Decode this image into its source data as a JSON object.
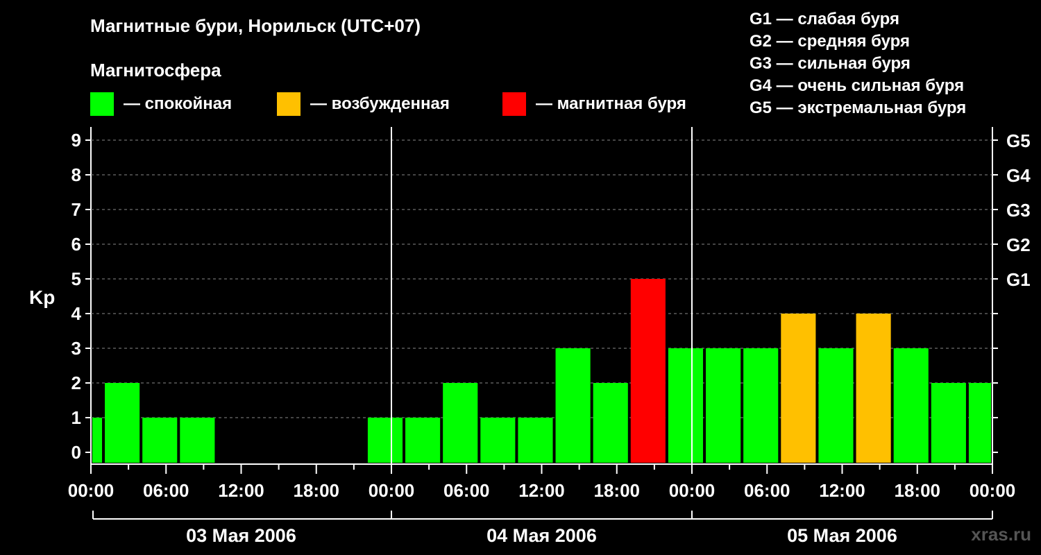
{
  "header": {
    "title": "Магнитные бури, Норильск (UTC+07)",
    "subtitle": "Магнитосфера"
  },
  "legend": {
    "items": [
      {
        "label": "— спокойная",
        "color": "#00ff00"
      },
      {
        "label": "— возбужденная",
        "color": "#ffc000"
      },
      {
        "label": "— магнитная буря",
        "color": "#ff0000"
      }
    ]
  },
  "g_scale_legend": [
    "G1 — слабая буря",
    "G2 — средняя буря",
    "G3 — сильная буря",
    "G4 — очень сильная буря",
    "G5 — экстремальная буря"
  ],
  "watermark": "xras.ru",
  "chart_data": {
    "type": "bar",
    "ylabel": "Kp",
    "ylim": [
      0,
      9
    ],
    "y_ticks": [
      0,
      1,
      2,
      3,
      4,
      5,
      6,
      7,
      8,
      9
    ],
    "right_axis_labels": [
      {
        "value": 5,
        "label": "G1"
      },
      {
        "value": 6,
        "label": "G2"
      },
      {
        "value": 7,
        "label": "G3"
      },
      {
        "value": 8,
        "label": "G4"
      },
      {
        "value": 9,
        "label": "G5"
      }
    ],
    "x_tick_labels": [
      "00:00",
      "06:00",
      "12:00",
      "18:00",
      "00:00",
      "06:00",
      "12:00",
      "18:00",
      "00:00",
      "06:00",
      "12:00",
      "18:00",
      "00:00"
    ],
    "day_labels": [
      "03 Мая 2006",
      "04 Мая 2006",
      "05 Мая 2006"
    ],
    "grid": "horizontal dashed",
    "x_range_hours": [
      0,
      72
    ],
    "bars": [
      {
        "start_hour": 0,
        "end_hour": 1,
        "value": 1,
        "status": "quiet"
      },
      {
        "start_hour": 1,
        "end_hour": 4,
        "value": 2,
        "status": "quiet"
      },
      {
        "start_hour": 4,
        "end_hour": 7,
        "value": 1,
        "status": "quiet"
      },
      {
        "start_hour": 7,
        "end_hour": 10,
        "value": 1,
        "status": "quiet"
      },
      {
        "start_hour": 22,
        "end_hour": 25,
        "value": 1,
        "status": "quiet"
      },
      {
        "start_hour": 25,
        "end_hour": 28,
        "value": 1,
        "status": "quiet"
      },
      {
        "start_hour": 28,
        "end_hour": 31,
        "value": 2,
        "status": "quiet"
      },
      {
        "start_hour": 31,
        "end_hour": 34,
        "value": 1,
        "status": "quiet"
      },
      {
        "start_hour": 34,
        "end_hour": 37,
        "value": 1,
        "status": "quiet"
      },
      {
        "start_hour": 37,
        "end_hour": 40,
        "value": 3,
        "status": "quiet"
      },
      {
        "start_hour": 40,
        "end_hour": 43,
        "value": 2,
        "status": "quiet"
      },
      {
        "start_hour": 43,
        "end_hour": 46,
        "value": 5,
        "status": "storm"
      },
      {
        "start_hour": 46,
        "end_hour": 49,
        "value": 3,
        "status": "quiet"
      },
      {
        "start_hour": 49,
        "end_hour": 52,
        "value": 3,
        "status": "quiet"
      },
      {
        "start_hour": 52,
        "end_hour": 55,
        "value": 3,
        "status": "quiet"
      },
      {
        "start_hour": 55,
        "end_hour": 58,
        "value": 4,
        "status": "excited"
      },
      {
        "start_hour": 58,
        "end_hour": 61,
        "value": 3,
        "status": "quiet"
      },
      {
        "start_hour": 61,
        "end_hour": 64,
        "value": 4,
        "status": "excited"
      },
      {
        "start_hour": 64,
        "end_hour": 67,
        "value": 3,
        "status": "quiet"
      },
      {
        "start_hour": 67,
        "end_hour": 70,
        "value": 2,
        "status": "quiet"
      },
      {
        "start_hour": 70,
        "end_hour": 72,
        "value": 2,
        "status": "quiet"
      }
    ],
    "status_colors": {
      "quiet": "#00ff00",
      "excited": "#ffc000",
      "storm": "#ff0000"
    }
  }
}
